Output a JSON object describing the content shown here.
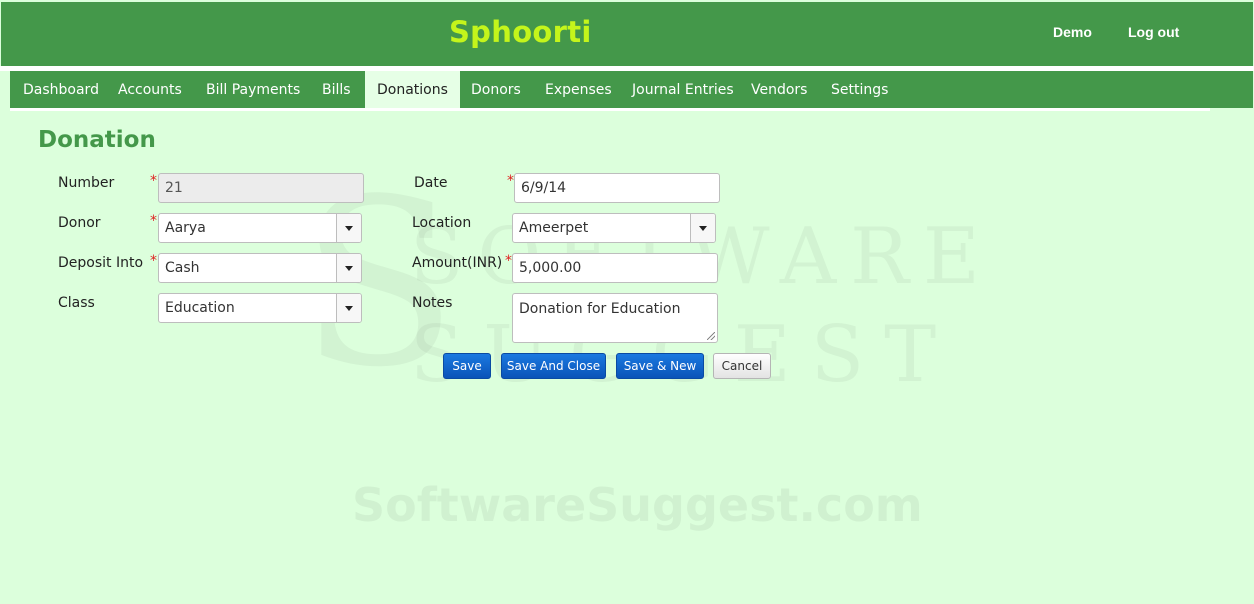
{
  "header": {
    "brand": "Sphoorti",
    "user_link": "Demo",
    "logout_link": "Log out"
  },
  "nav": {
    "tabs": [
      {
        "label": "Dashboard"
      },
      {
        "label": "Accounts"
      },
      {
        "label": "Bill Payments"
      },
      {
        "label": "Bills"
      },
      {
        "label": "Donations",
        "active": true
      },
      {
        "label": "Donors"
      },
      {
        "label": "Expenses"
      },
      {
        "label": "Journal Entries"
      },
      {
        "label": "Vendors"
      },
      {
        "label": "Settings"
      }
    ]
  },
  "page": {
    "title": "Donation"
  },
  "form": {
    "required_mark": "*",
    "number": {
      "label": "Number",
      "value": "21"
    },
    "donor": {
      "label": "Donor",
      "value": "Aarya"
    },
    "deposit_into": {
      "label": "Deposit Into",
      "value": "Cash"
    },
    "class": {
      "label": "Class",
      "value": "Education"
    },
    "date": {
      "label": "Date",
      "value": "6/9/14"
    },
    "location": {
      "label": "Location",
      "value": "Ameerpet"
    },
    "amount": {
      "label": "Amount(INR)",
      "value": "5,000.00"
    },
    "notes": {
      "label": "Notes",
      "value": "Donation for Education"
    }
  },
  "actions": {
    "save": "Save",
    "save_and_close": "Save And Close",
    "save_and_new": "Save & New",
    "cancel": "Cancel"
  },
  "watermark": {
    "logo_line1": "SOFTWARE",
    "logo_line2": "SUGGEST",
    "url": "SoftwareSuggest.com"
  },
  "colors": {
    "header_green": "#44984a",
    "brand_text": "#c4f51b",
    "page_bg": "#dcffdc",
    "primary_button": "#0a53b8",
    "required": "#e02020"
  }
}
